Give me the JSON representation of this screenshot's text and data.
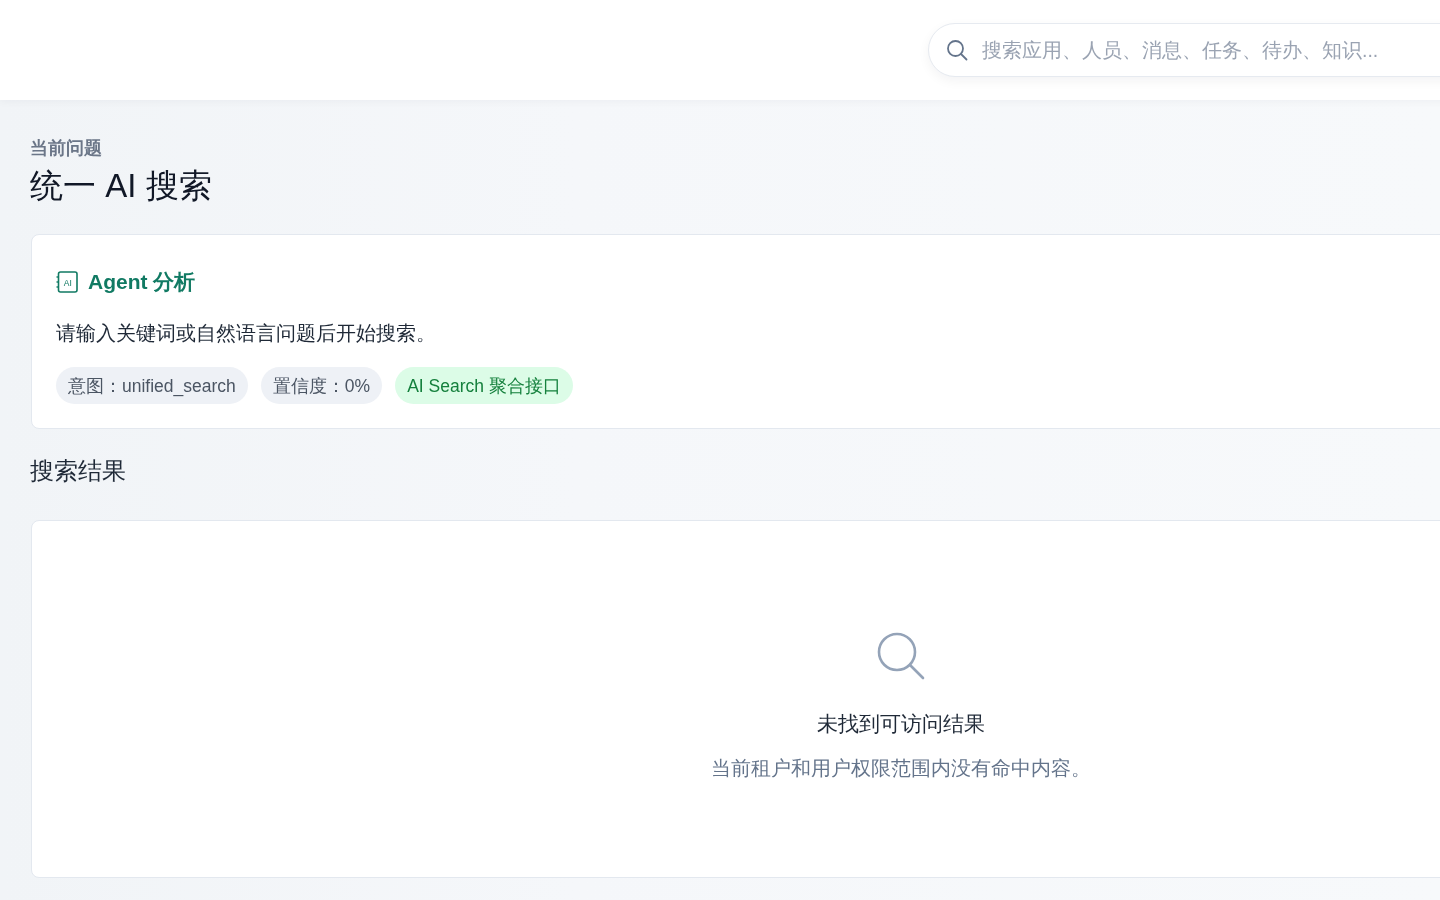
{
  "header": {
    "search": {
      "placeholder": "搜索应用、人员、消息、任务、待办、知识..."
    }
  },
  "question": {
    "label": "当前问题",
    "title": "统一 AI 搜索"
  },
  "agent_card": {
    "badge": "AI",
    "title": "Agent 分析",
    "message": "请输入关键词或自然语言问题后开始搜索。",
    "tags": [
      {
        "label": "意图：unified_search",
        "kind": "neutral"
      },
      {
        "label": "置信度：0%",
        "kind": "neutral"
      },
      {
        "label": "AI Search 聚合接口",
        "kind": "success"
      }
    ]
  },
  "results": {
    "heading": "搜索结果",
    "empty_state": {
      "title": "未找到可访问结果",
      "description": "当前租户和用户权限范围内没有命中内容。"
    }
  }
}
